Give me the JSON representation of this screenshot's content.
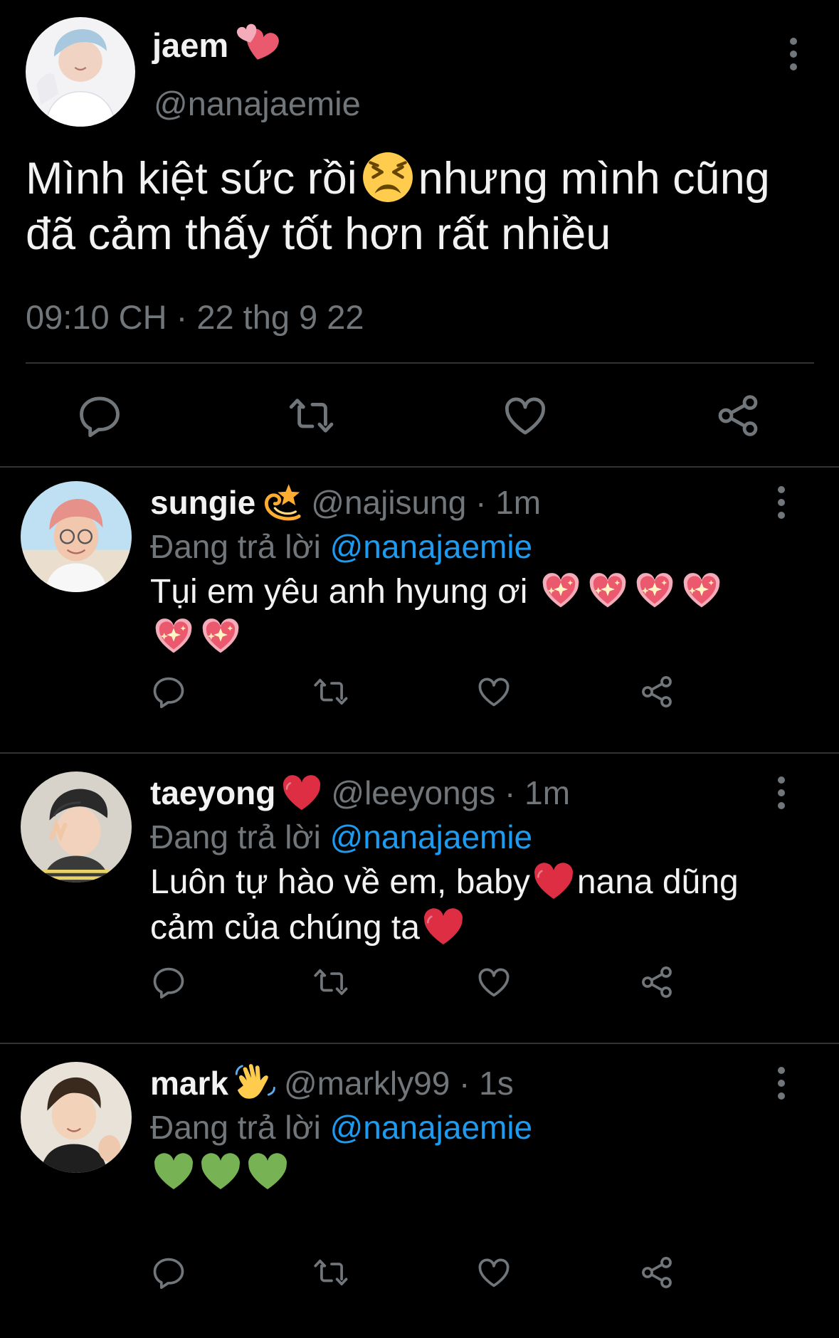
{
  "colors": {
    "background": "#000000",
    "text": "#e7e9ea",
    "muted": "#71767b",
    "link": "#1d9bf0",
    "divider": "#2f3336"
  },
  "main_tweet": {
    "author_name": "jaem",
    "author_emoji": "two-hearts-emoji",
    "author_handle": "@nanajaemie",
    "text_part1": "Mình kiệt sức rồi",
    "text_emoji": "persevering-face-emoji",
    "text_part2": "nhưng mình cũng đã cảm thấy tốt hơn rất nhiều",
    "timestamp": "09:10 CH · 22 thg 9 22",
    "more_icon": "more-vertical-icon",
    "actions": [
      "reply-icon",
      "retweet-icon",
      "like-icon",
      "share-icon"
    ]
  },
  "replies": [
    {
      "name": "sungie",
      "name_emoji": "dizzy-emoji",
      "handle": "@najisung",
      "time": "1m",
      "replying_label": "Đang trả lời",
      "replying_to": "@nanajaemie",
      "text": "Tụi em yêu anh hyung ơi",
      "text_emojis": [
        "sparkling-heart-emoji",
        "sparkling-heart-emoji",
        "sparkling-heart-emoji",
        "sparkling-heart-emoji",
        "sparkling-heart-emoji",
        "sparkling-heart-emoji"
      ]
    },
    {
      "name": "taeyong",
      "name_emoji": "red-heart-emoji",
      "handle": "@leeyongs",
      "time": "1m",
      "replying_label": "Đang trả lời",
      "replying_to": "@nanajaemie",
      "text_part1": "Luôn tự hào về em, baby",
      "text_emoji1": "red-heart-emoji",
      "text_part2": "nana dũng cảm của chúng ta",
      "text_emoji2": "red-heart-emoji"
    },
    {
      "name": "mark",
      "name_emoji": "waving-hand-emoji",
      "handle": "@markly99",
      "time": "1s",
      "replying_label": "Đang trả lời",
      "replying_to": "@nanajaemie",
      "text_emojis": [
        "green-heart-emoji",
        "green-heart-emoji",
        "green-heart-emoji"
      ]
    }
  ]
}
